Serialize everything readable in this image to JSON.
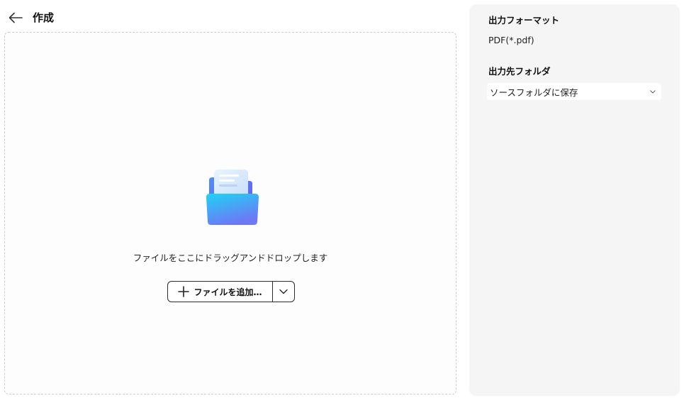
{
  "header": {
    "title": "作成",
    "back_icon": "arrow-left-icon"
  },
  "dropzone": {
    "hint": "ファイルをここにドラッグアンドドロップします",
    "illustration": "folder-documents-icon",
    "add_button_label": "ファイルを追加…",
    "add_icon": "plus-icon",
    "dropdown_icon": "chevron-down-icon"
  },
  "settings": {
    "output_format": {
      "title": "出力フォーマット",
      "value": "PDF(*.pdf)"
    },
    "output_folder": {
      "title": "出力先フォルダ",
      "selected": "ソースフォルダに保存"
    }
  },
  "colors": {
    "panel_bg": "#f5f5f5",
    "folder_top": "#22c8f5",
    "folder_bottom": "#6d7cf6",
    "border": "#2b2b2b"
  }
}
